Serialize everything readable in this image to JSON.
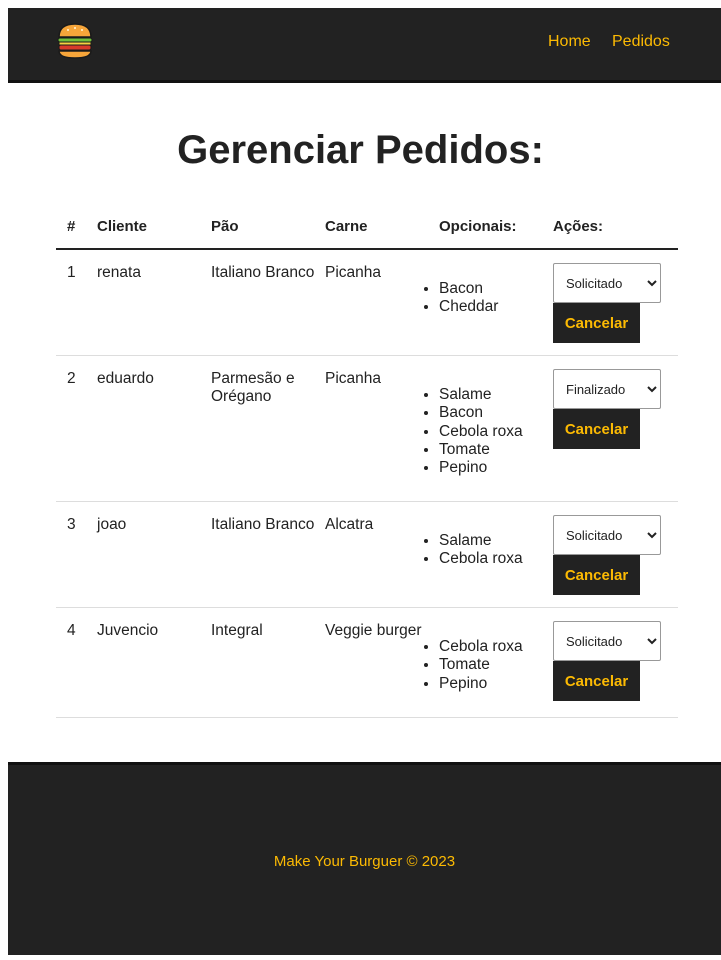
{
  "navbar": {
    "logo_icon": "burger-icon",
    "links": [
      {
        "label": "Home"
      },
      {
        "label": "Pedidos"
      }
    ],
    "accent_color": "#fcba03",
    "background_color": "#222222"
  },
  "page": {
    "title": "Gerenciar Pedidos:"
  },
  "table": {
    "headers": {
      "id": "#",
      "client": "Cliente",
      "bread": "Pão",
      "meat": "Carne",
      "options": "Opcionais:",
      "actions": "Ações:"
    },
    "rows": [
      {
        "id": "1",
        "client": "renata",
        "bread": "Italiano Branco",
        "meat": "Picanha",
        "options": [
          "Bacon",
          "Cheddar"
        ],
        "status": "Solicitado",
        "cancel_label": "Cancelar"
      },
      {
        "id": "2",
        "client": "eduardo",
        "bread": "Parmesão e Orégano",
        "meat": "Picanha",
        "options": [
          "Salame",
          "Bacon",
          "Cebola roxa",
          "Tomate",
          "Pepino"
        ],
        "status": "Finalizado",
        "cancel_label": "Cancelar"
      },
      {
        "id": "3",
        "client": "joao",
        "bread": "Italiano Branco",
        "meat": "Alcatra",
        "options": [
          "Salame",
          "Cebola roxa"
        ],
        "status": "Solicitado",
        "cancel_label": "Cancelar"
      },
      {
        "id": "4",
        "client": "Juvencio",
        "bread": "Integral",
        "meat": "Veggie burger",
        "options": [
          "Cebola roxa",
          "Tomate",
          "Pepino"
        ],
        "status": "Solicitado",
        "cancel_label": "Cancelar"
      }
    ]
  },
  "footer": {
    "text": "Make Your Burguer © 2023"
  }
}
